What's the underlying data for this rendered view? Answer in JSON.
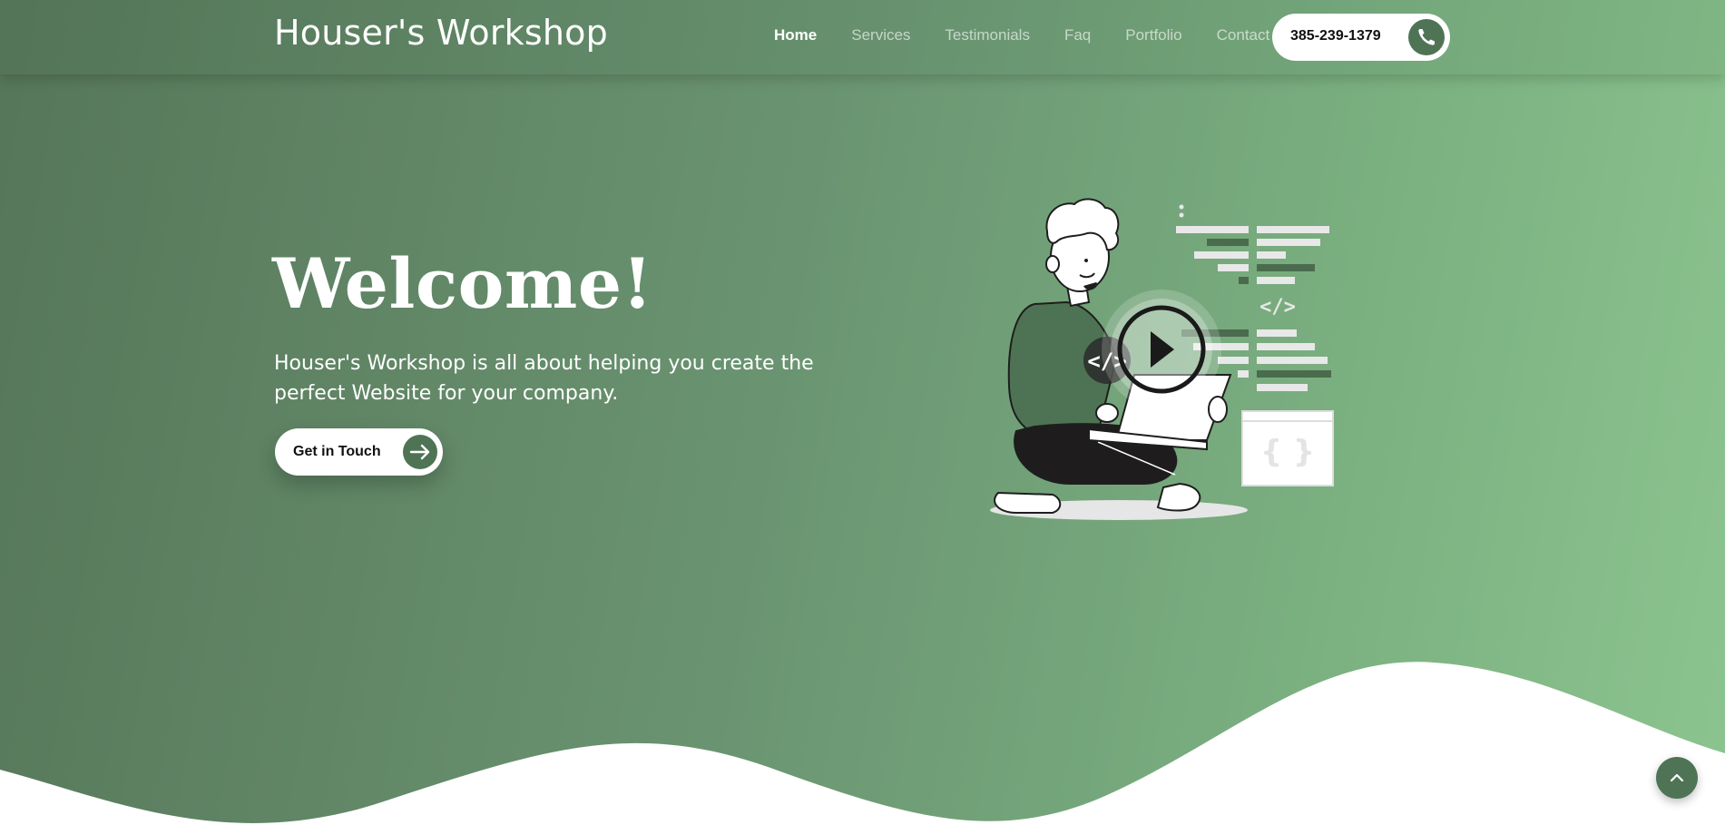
{
  "header": {
    "brand": "Houser's Workshop",
    "nav": [
      {
        "label": "Home",
        "active": true
      },
      {
        "label": "Services",
        "active": false
      },
      {
        "label": "Testimonials",
        "active": false
      },
      {
        "label": "Faq",
        "active": false
      },
      {
        "label": "Portfolio",
        "active": false
      },
      {
        "label": "Contact",
        "active": false
      }
    ],
    "phone": "385-239-1379",
    "phone_icon": "phone-icon"
  },
  "hero": {
    "title": "Welcome!",
    "description": "Houser's Workshop is all about helping you create the perfect Website for your company.",
    "cta_label": "Get in Touch",
    "cta_icon": "arrow-right-icon",
    "illustration_labels": {
      "code_tag": "</>",
      "braces": "{ }"
    }
  },
  "scroll_top_icon": "chevron-up-icon",
  "colors": {
    "accent": "#4f7455",
    "gradient_start": "#567659",
    "gradient_end": "#8cc48f",
    "background": "#ffffff"
  }
}
